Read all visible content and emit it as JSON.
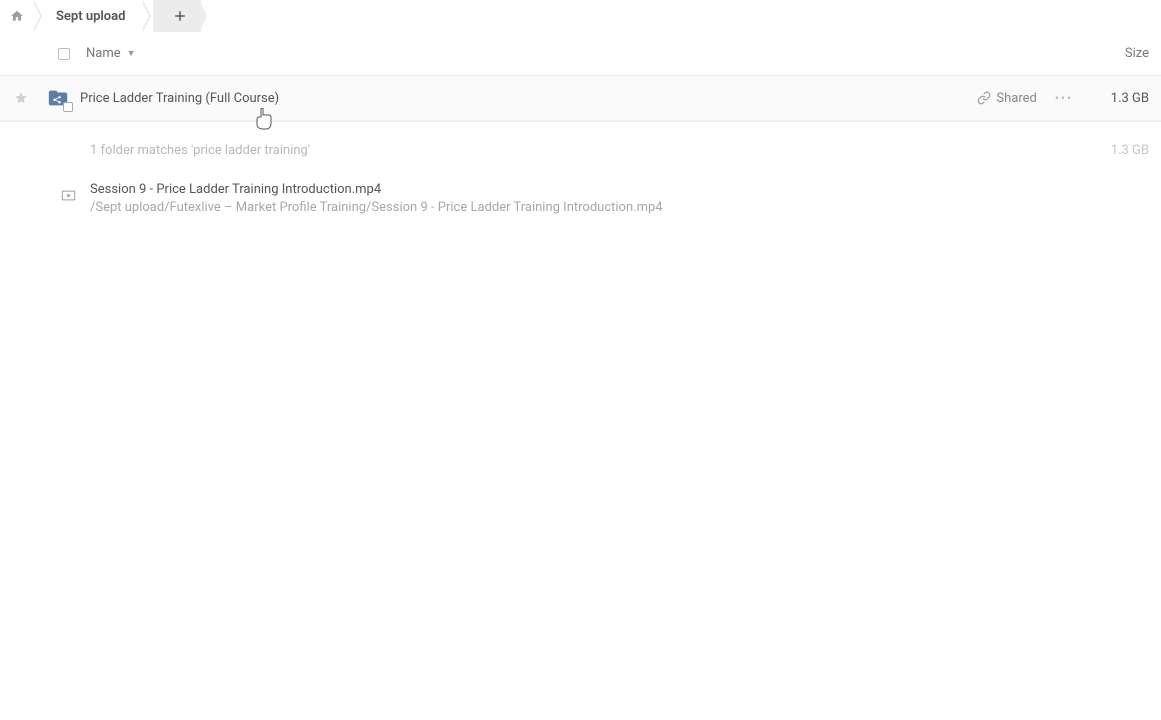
{
  "breadcrumb": {
    "current": "Sept upload"
  },
  "columns": {
    "name": "Name",
    "size": "Size"
  },
  "folder": {
    "name": "Price Ladder Training (Full Course)",
    "shared_label": "Shared",
    "size": "1.3 GB"
  },
  "matches": {
    "text": "1 folder matches 'price ladder training'",
    "size": "1.3 GB"
  },
  "file": {
    "name": "Session 9 - Price Ladder Training Introduction.mp4",
    "path": "/Sept upload/Futexlive – Market Profile Training/Session 9 - Price Ladder Training Introduction.mp4"
  }
}
